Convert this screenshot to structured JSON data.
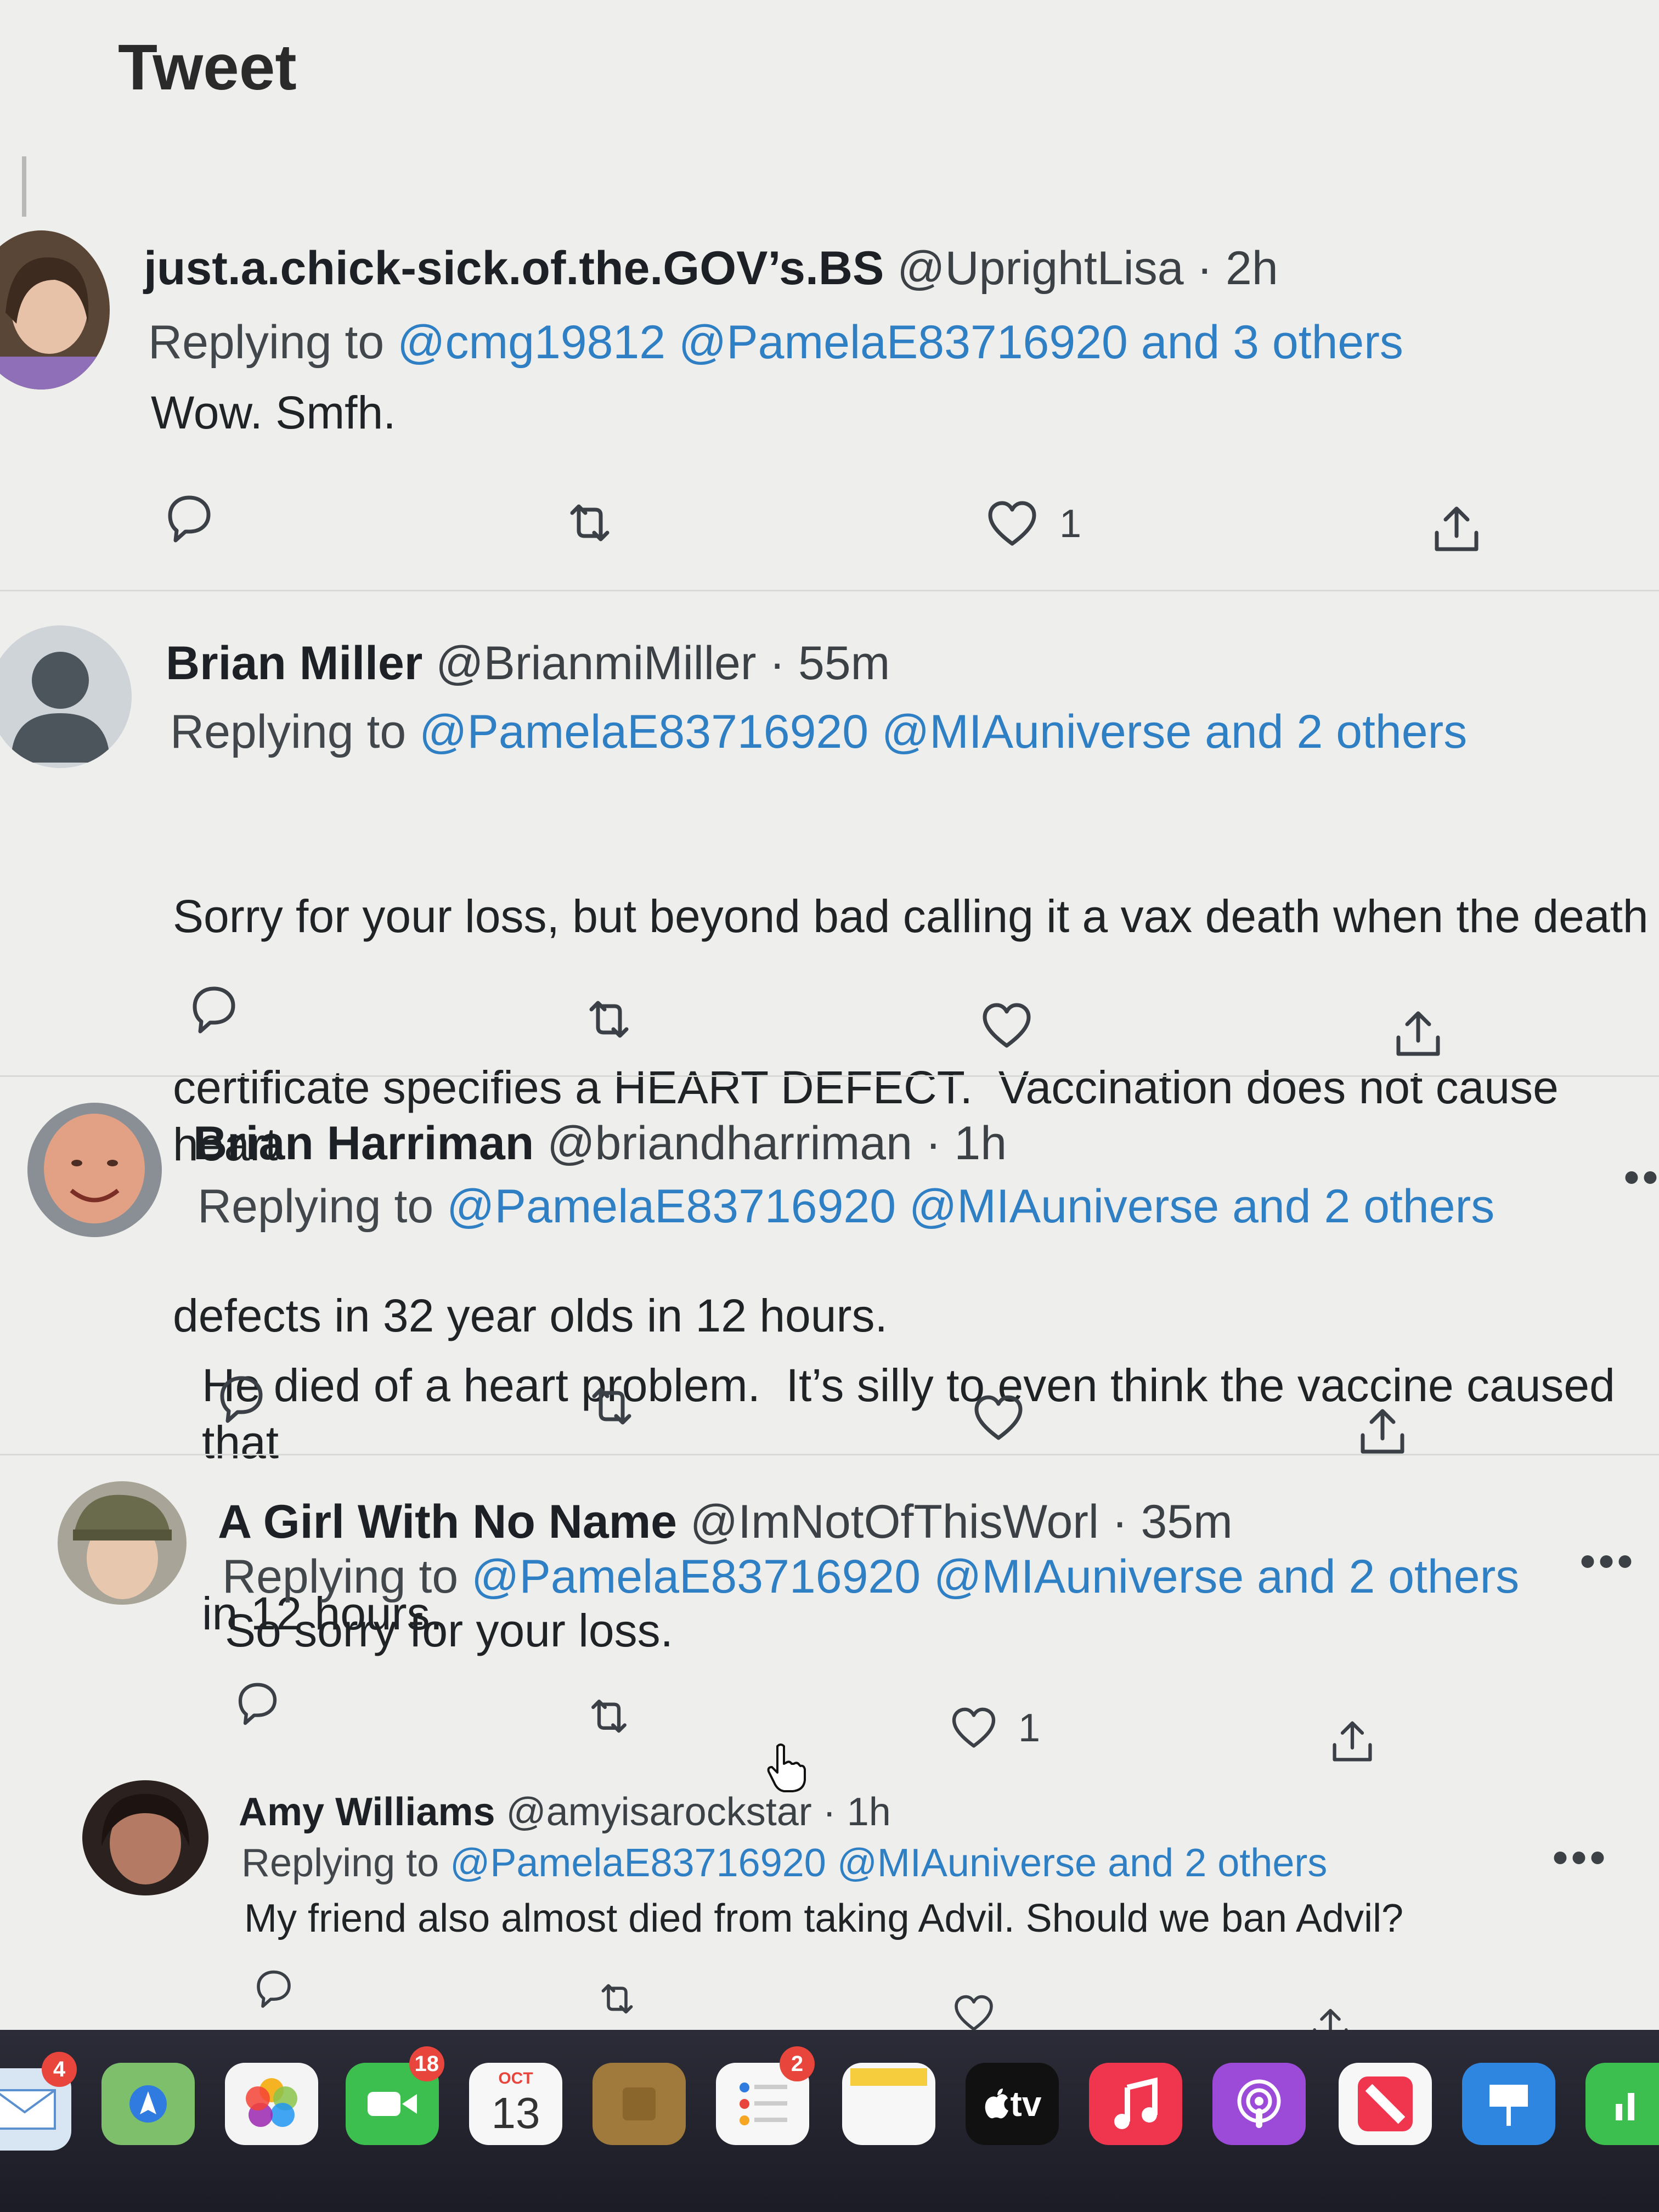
{
  "page": {
    "title": "Tweet"
  },
  "tweets": [
    {
      "name": "just.a.chick-sick.of.the.GOV’s.BS",
      "handle": "@UprightLisa",
      "time": "2h",
      "replying_prefix": "Replying to",
      "mentions": "@cmg19812 @PamelaE83716920 and 3 others",
      "text": "Wow. Smfh.",
      "likes": "1"
    },
    {
      "name": "Brian Miller",
      "handle": "@BrianmiMiller",
      "time": "55m",
      "replying_prefix": "Replying to",
      "mentions": "@PamelaE83716920 @MIAuniverse and 2 others",
      "text_lines": [
        "Sorry for your loss, but beyond bad calling it a vax death when the death",
        "certificate specifies a HEART DEFECT.  Vaccination does not cause heart",
        "defects in 32 year olds in 12 hours."
      ]
    },
    {
      "name": "Brian Harriman",
      "handle": "@briandharriman",
      "time": "1h",
      "replying_prefix": "Replying to",
      "mentions": "@PamelaE83716920 @MIAuniverse and 2 others",
      "text_lines": [
        "He died of a heart problem.  It’s silly to even think the vaccine caused that",
        "in 12 hours."
      ]
    },
    {
      "name": "A Girl With No Name",
      "handle": "@ImNotOfThisWorl",
      "time": "35m",
      "replying_prefix": "Replying to",
      "mentions": "@PamelaE83716920 @MIAuniverse and 2 others",
      "text": "So sorry for your loss.",
      "likes": "1"
    },
    {
      "name": "Amy Williams",
      "handle": "@amyisarockstar",
      "time": "1h",
      "replying_prefix": "Replying to",
      "mentions": "@PamelaE83716920 @MIAuniverse and 2 others",
      "text": "My friend also almost died from taking Advil. Should we ban Advil?"
    }
  ],
  "separator": "·",
  "more_glyph": "•••",
  "dock": {
    "mail_badge": "4",
    "facetime_badge": "18",
    "calendar_month": "OCT",
    "calendar_day": "13",
    "reminders_badge": "2",
    "tv_label": "tv"
  },
  "colors": {
    "mention": "#2f7fc4",
    "background": "#eeeeec",
    "badge": "#e8453c"
  },
  "icons": [
    "reply-icon",
    "retweet-icon",
    "like-icon",
    "share-icon",
    "more-icon",
    "hand-cursor-icon"
  ]
}
